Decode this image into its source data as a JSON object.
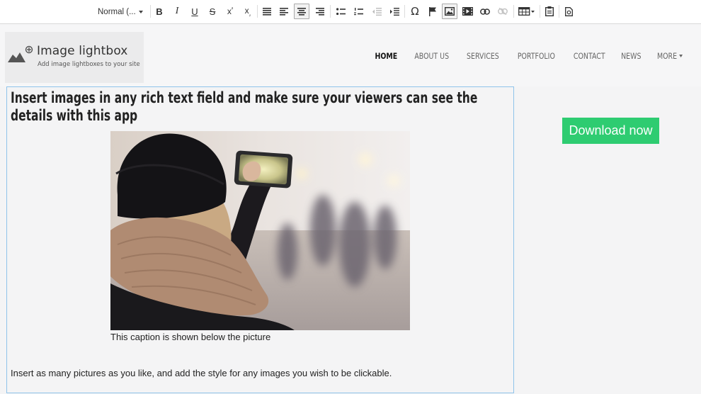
{
  "toolbar": {
    "format_label": "Normal (...",
    "buttons": {
      "bold": "B",
      "italic": "I",
      "underline": "U",
      "strike": "S",
      "superscript_base": "x",
      "superscript_mark": "²",
      "subscript_base": "x",
      "subscript_mark": "₂",
      "special_char": "Ω"
    }
  },
  "header": {
    "logo_title": "Image lightbox",
    "logo_subtitle": "Add image lightboxes to your site",
    "nav": [
      {
        "label": "HOME",
        "active": true
      },
      {
        "label": "ABOUT US"
      },
      {
        "label": "SERVICES"
      },
      {
        "label": "PORTFOLIO"
      },
      {
        "label": "CONTACT"
      },
      {
        "label": "NEWS"
      },
      {
        "label": "MORE"
      }
    ]
  },
  "content": {
    "title": "Insert images in any rich text field and make sure your viewers can see the details with this app",
    "caption": "This caption is shown below the picture",
    "body": "Insert as many pictures as you like, and add the style for any images you wish to be clickable."
  },
  "sidebar": {
    "download_label": "Download now"
  },
  "colors": {
    "accent_green": "#2ecc71",
    "content_border": "#8fc3ea",
    "background": "#f4f4f5"
  },
  "icons": [
    "format-dropdown-caret-icon",
    "bold-icon",
    "italic-icon",
    "underline-icon",
    "strikethrough-icon",
    "superscript-icon",
    "subscript-icon",
    "justify-icon",
    "align-left-icon",
    "align-center-icon",
    "align-right-icon",
    "bulleted-list-icon",
    "numbered-list-icon",
    "outdent-icon",
    "indent-icon",
    "special-character-icon",
    "anchor-flag-icon",
    "image-icon",
    "video-icon",
    "link-icon",
    "unlink-icon",
    "table-icon",
    "paste-icon",
    "source-icon",
    "logo-image-icon"
  ]
}
